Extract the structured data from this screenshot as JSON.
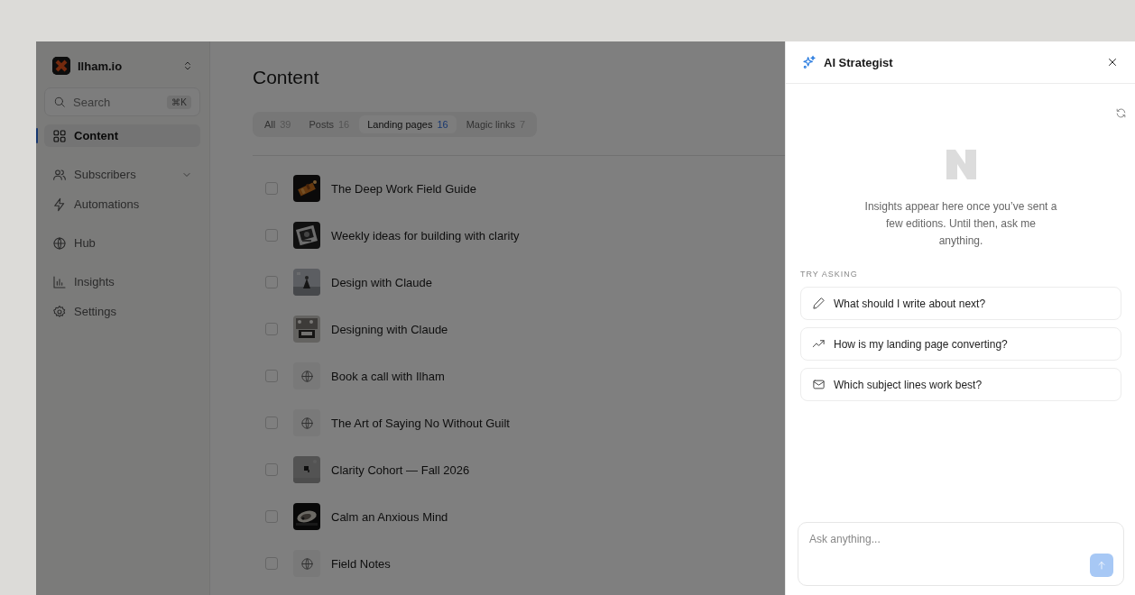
{
  "workspace": {
    "name": "Ilham.io"
  },
  "search": {
    "placeholder": "Search",
    "shortcut": "⌘K"
  },
  "sidebar": {
    "sections": [
      {
        "items": [
          {
            "label": "Content",
            "kind": "grid",
            "selected": true,
            "chevron": false
          }
        ]
      },
      {
        "items": [
          {
            "label": "Subscribers",
            "kind": "users",
            "selected": false,
            "chevron": true
          },
          {
            "label": "Automations",
            "kind": "bolt",
            "selected": false,
            "chevron": false
          }
        ]
      },
      {
        "items": [
          {
            "label": "Hub",
            "kind": "globe",
            "selected": false,
            "chevron": false
          }
        ]
      },
      {
        "items": [
          {
            "label": "Insights",
            "kind": "chart",
            "selected": false,
            "chevron": false
          },
          {
            "label": "Settings",
            "kind": "gear",
            "selected": false,
            "chevron": false
          }
        ]
      }
    ]
  },
  "page": {
    "title": "Content"
  },
  "tabs": [
    {
      "label": "All",
      "count": "39",
      "selected": false
    },
    {
      "label": "Posts",
      "count": "16",
      "selected": false
    },
    {
      "label": "Landing pages",
      "count": "16",
      "selected": true
    },
    {
      "label": "Magic links",
      "count": "7",
      "selected": false
    }
  ],
  "rows": [
    {
      "title": "The Deep Work Field Guide",
      "kind": "picture",
      "checked": false
    },
    {
      "title": "Weekly ideas for building with clarity",
      "kind": "picture",
      "checked": false
    },
    {
      "title": "Design with Claude",
      "kind": "picture",
      "checked": false
    },
    {
      "title": "Designing with Claude",
      "kind": "picture",
      "checked": false
    },
    {
      "title": "Book a call with Ilham",
      "kind": "globe",
      "checked": false
    },
    {
      "title": "The Art of Saying No Without Guilt",
      "kind": "globe",
      "checked": false
    },
    {
      "title": "Clarity Cohort — Fall 2026",
      "kind": "picture",
      "checked": false
    },
    {
      "title": "Calm an Anxious Mind",
      "kind": "picture",
      "checked": false
    },
    {
      "title": "Field Notes",
      "kind": "globe",
      "checked": false
    }
  ],
  "assistant": {
    "title": "AI Strategist",
    "message": "Insights appear here once you’ve sent a few editions. Until then, ask me anything.",
    "suggestions_heading": "TRY ASKING",
    "suggestions": [
      {
        "text": "What should I write about next?",
        "kind": "pencil"
      },
      {
        "text": "How is my landing page converting?",
        "kind": "trend"
      },
      {
        "text": "Which subject lines work best?",
        "kind": "mail"
      }
    ],
    "input": {
      "placeholder": "Ask anything..."
    }
  }
}
